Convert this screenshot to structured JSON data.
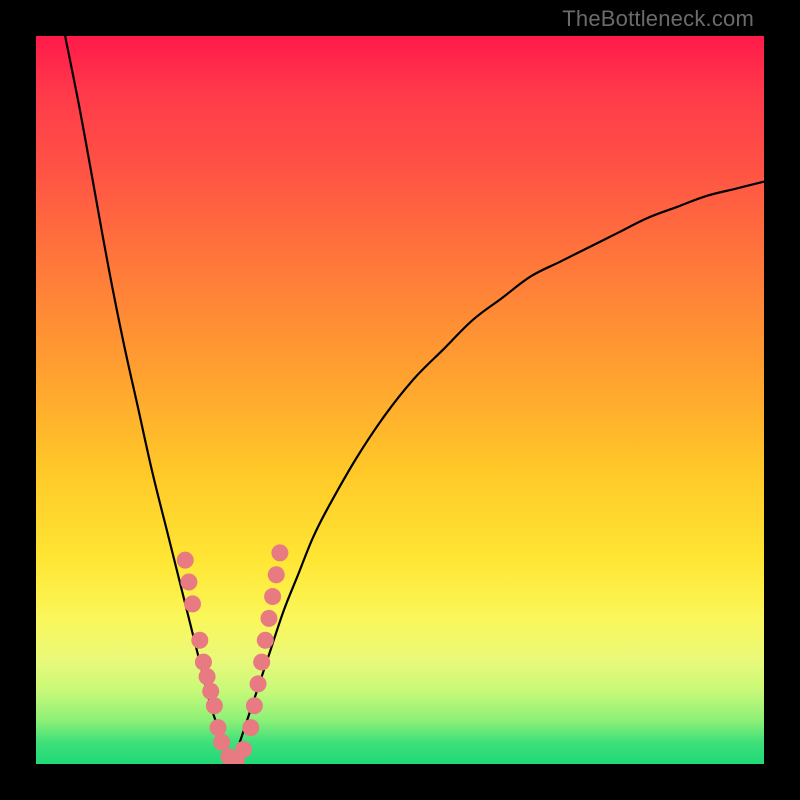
{
  "watermark": "TheBottleneck.com",
  "colors": {
    "gradient_top": "#ff1a4a",
    "gradient_mid": "#ffe634",
    "gradient_bottom": "#1fd977",
    "curve": "#000000",
    "dots": "#e87a81",
    "frame": "#000000"
  },
  "chart_data": {
    "type": "line",
    "title": "",
    "xlabel": "",
    "ylabel": "",
    "xlim": [
      0,
      100
    ],
    "ylim": [
      0,
      100
    ],
    "grid": false,
    "legend": false,
    "series": [
      {
        "name": "left-curve",
        "description": "Steep descending branch (left side of V)",
        "x": [
          4,
          6,
          8,
          10,
          12,
          14,
          16,
          18,
          20,
          21,
          22,
          23,
          24,
          25,
          26,
          27
        ],
        "y": [
          100,
          90,
          79,
          68,
          58,
          49,
          40,
          32,
          24,
          20,
          16,
          12,
          8,
          5,
          2,
          0
        ]
      },
      {
        "name": "right-curve",
        "description": "Rising branch (right side of V), concave decreasing slope",
        "x": [
          27,
          28,
          30,
          32,
          34,
          36,
          38,
          40,
          44,
          48,
          52,
          56,
          60,
          64,
          68,
          72,
          76,
          80,
          84,
          88,
          92,
          96,
          100
        ],
        "y": [
          0,
          3,
          9,
          15,
          21,
          26,
          31,
          35,
          42,
          48,
          53,
          57,
          61,
          64,
          67,
          69,
          71,
          73,
          75,
          76.5,
          78,
          79,
          80
        ]
      }
    ],
    "dots": {
      "name": "highlighted-points",
      "description": "Salmon-colored beads clustered near the V bottom",
      "points": [
        {
          "x": 20.5,
          "y": 28
        },
        {
          "x": 21.0,
          "y": 25
        },
        {
          "x": 21.5,
          "y": 22
        },
        {
          "x": 22.5,
          "y": 17
        },
        {
          "x": 23.0,
          "y": 14
        },
        {
          "x": 23.5,
          "y": 12
        },
        {
          "x": 24.0,
          "y": 10
        },
        {
          "x": 24.5,
          "y": 8
        },
        {
          "x": 25.0,
          "y": 5
        },
        {
          "x": 25.5,
          "y": 3
        },
        {
          "x": 26.5,
          "y": 1
        },
        {
          "x": 27.5,
          "y": 0.5
        },
        {
          "x": 28.5,
          "y": 2
        },
        {
          "x": 29.5,
          "y": 5
        },
        {
          "x": 30.0,
          "y": 8
        },
        {
          "x": 30.5,
          "y": 11
        },
        {
          "x": 31.0,
          "y": 14
        },
        {
          "x": 31.5,
          "y": 17
        },
        {
          "x": 32.0,
          "y": 20
        },
        {
          "x": 32.5,
          "y": 23
        },
        {
          "x": 33.0,
          "y": 26
        },
        {
          "x": 33.5,
          "y": 29
        }
      ]
    }
  }
}
